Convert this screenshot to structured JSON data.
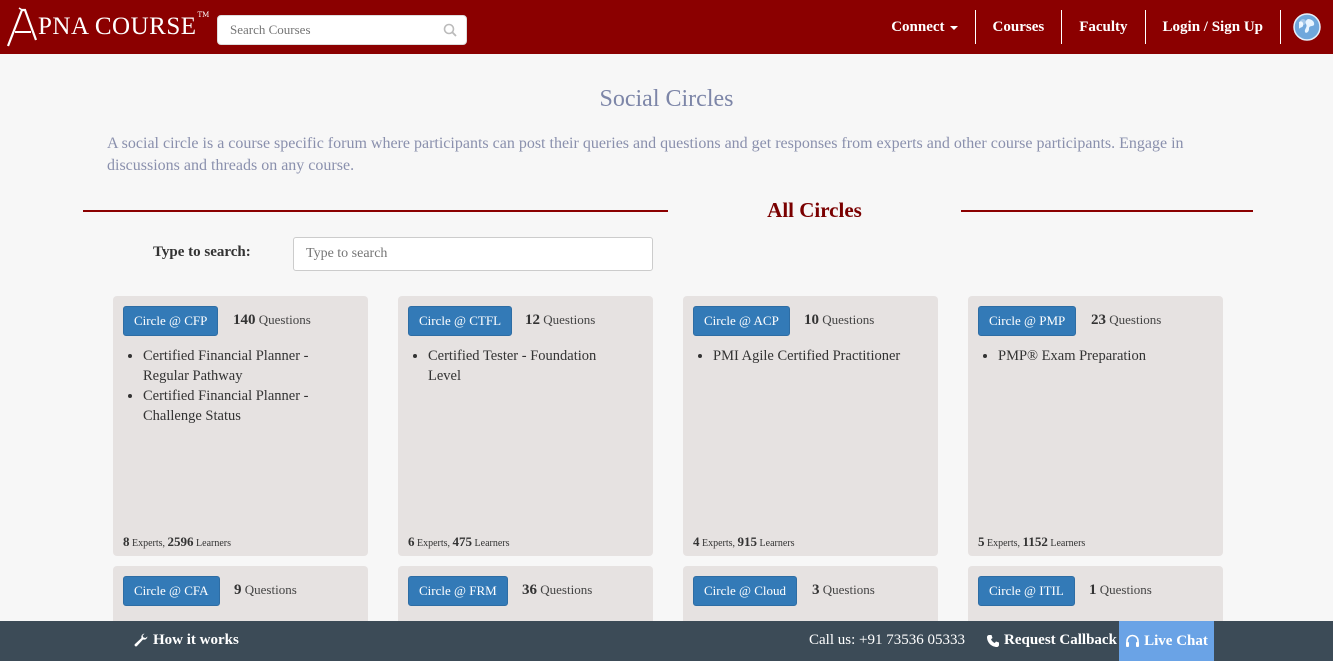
{
  "brand": {
    "logo_text": "PNA COURSE",
    "logo_letter": "A",
    "trademark": "TM"
  },
  "nav": {
    "search_placeholder": "Search Courses",
    "connect_label": "Connect",
    "courses_label": "Courses",
    "faculty_label": "Faculty",
    "login_label": "Login / Sign Up"
  },
  "header": {
    "title": "Social Circles",
    "intro": "A social circle is a course specific forum where participants can post their queries and questions and get responses from experts and other course participants. Engage in discussions and threads on any course.",
    "section_title": "All Circles",
    "search_label": "Type to search:",
    "search_placeholder": "Type to search"
  },
  "cards": [
    {
      "button": "Circle @ CFP",
      "questions": "140",
      "questions_label": "Questions",
      "courses": [
        "Certified Financial Planner - Regular Pathway",
        "Certified Financial Planner - Challenge Status"
      ],
      "experts": "8",
      "learners": "2596"
    },
    {
      "button": "Circle @ CTFL",
      "questions": "12",
      "questions_label": "Questions",
      "courses": [
        "Certified Tester - Foundation Level"
      ],
      "experts": "6",
      "learners": "475"
    },
    {
      "button": "Circle @ ACP",
      "questions": "10",
      "questions_label": "Questions",
      "courses": [
        "PMI Agile Certified Practitioner"
      ],
      "experts": "4",
      "learners": "915"
    },
    {
      "button": "Circle @ PMP",
      "questions": "23",
      "questions_label": "Questions",
      "courses": [
        "PMP® Exam Preparation"
      ],
      "experts": "5",
      "learners": "1152"
    },
    {
      "button": "Circle @ CFA",
      "questions": "9",
      "questions_label": "Questions",
      "courses": [],
      "experts": "",
      "learners": ""
    },
    {
      "button": "Circle @ FRM",
      "questions": "36",
      "questions_label": "Questions",
      "courses": [],
      "experts": "",
      "learners": ""
    },
    {
      "button": "Circle @ Cloud",
      "questions": "3",
      "questions_label": "Questions",
      "courses": [],
      "experts": "",
      "learners": ""
    },
    {
      "button": "Circle @ ITIL",
      "questions": "1",
      "questions_label": "Questions",
      "courses": [],
      "experts": "",
      "learners": ""
    }
  ],
  "stats_labels": {
    "experts": "Experts,",
    "learners": "Learners"
  },
  "footer": {
    "how_it_works": "How it works",
    "call_us": "Call us: +91 73536 05333",
    "request_callback": "Request Callback",
    "live_chat": "Live Chat"
  }
}
